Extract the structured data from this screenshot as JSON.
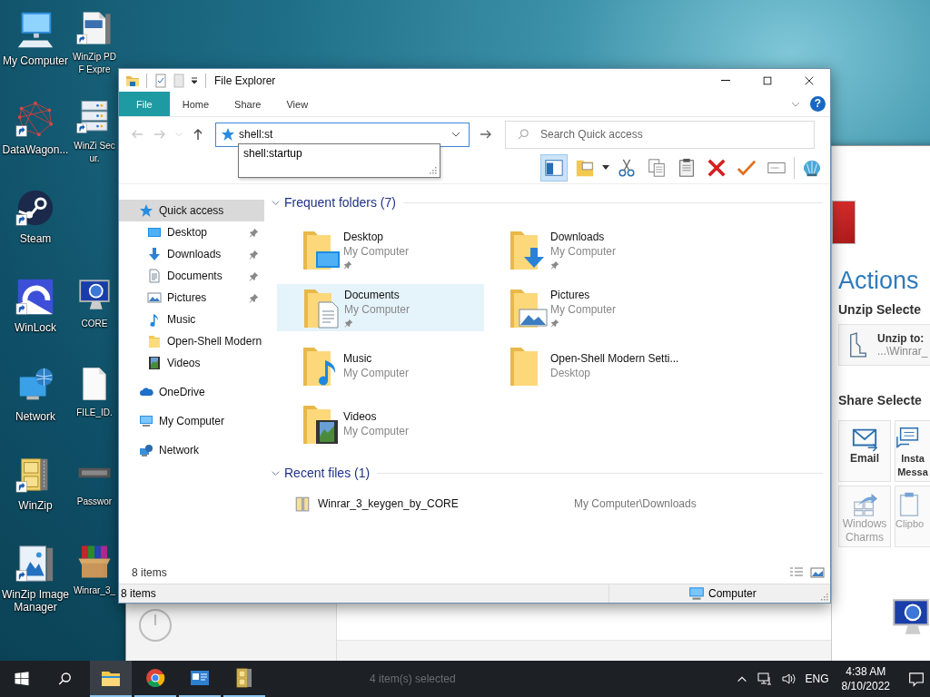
{
  "desktop": {
    "rows": [
      {
        "icons": [
          {
            "label": "My Computer",
            "kind": "computer",
            "shortcut": false
          },
          {
            "label": "WinZip PDF Expre",
            "kind": "pdf",
            "shortcut": true
          }
        ]
      },
      {
        "icons": [
          {
            "label": "DataWagon...",
            "kind": "graph",
            "shortcut": true
          },
          {
            "label": "WinZi Secur.",
            "kind": "server",
            "shortcut": true
          }
        ]
      },
      {
        "icons": [
          {
            "label": "Steam",
            "kind": "steam",
            "shortcut": true
          }
        ]
      },
      {
        "icons": [
          {
            "label": "WinLock",
            "kind": "winlock",
            "shortcut": true
          },
          {
            "label": "CORE",
            "kind": "info",
            "shortcut": false
          }
        ]
      },
      {
        "icons": [
          {
            "label": "Network",
            "kind": "network",
            "shortcut": false
          },
          {
            "label": "FILE_ID.",
            "kind": "file",
            "shortcut": false
          }
        ]
      },
      {
        "icons": [
          {
            "label": "WinZip",
            "kind": "cabinet",
            "shortcut": true
          },
          {
            "label": "Passwor",
            "kind": "password",
            "shortcut": false
          }
        ]
      },
      {
        "icons": [
          {
            "label": "WinZip Image Manager",
            "kind": "image",
            "shortcut": true
          },
          {
            "label": "Winrar_3_",
            "kind": "box",
            "shortcut": false
          }
        ]
      }
    ]
  },
  "background_window": {
    "actions": {
      "heading": "Actions",
      "unzip_heading": "Unzip Selecte",
      "unzip_card": {
        "title": "Unzip to:",
        "path": "...\\Winrar_"
      },
      "share_heading": "Share Selecte",
      "tiles": [
        {
          "label": "Email",
          "kind": "email",
          "disabled": false
        },
        {
          "label": "Insta Messa",
          "kind": "chat",
          "disabled": false
        },
        {
          "label": "Windows Charms",
          "kind": "charms",
          "disabled": true
        },
        {
          "label": "Clipbo",
          "kind": "clipboard",
          "disabled": true
        }
      ]
    },
    "status": "4 item(s) selected"
  },
  "explorer": {
    "title": "File Explorer",
    "ribbon_tabs": [
      {
        "label": "File",
        "kind": "menu"
      },
      {
        "label": "Home",
        "kind": "tab"
      },
      {
        "label": "Share",
        "kind": "tab"
      },
      {
        "label": "View",
        "kind": "tab"
      }
    ],
    "help_glyph": "?",
    "address": {
      "value": "shell:st",
      "suggestions": [
        "shell:startup"
      ]
    },
    "search": {
      "placeholder": "Search Quick access"
    },
    "nav": [
      {
        "label": "Quick access",
        "kind": "star",
        "selected": true,
        "children": [
          {
            "label": "Desktop",
            "kind": "desktop",
            "selected": false,
            "pinned": true
          },
          {
            "label": "Downloads",
            "kind": "download",
            "selected": false,
            "pinned": true
          },
          {
            "label": "Documents",
            "kind": "docs",
            "selected": false,
            "pinned": true
          },
          {
            "label": "Pictures",
            "kind": "pictures",
            "selected": false,
            "pinned": true
          },
          {
            "label": "Music",
            "kind": "music",
            "selected": false,
            "pinned": false
          },
          {
            "label": "Open-Shell Modern",
            "kind": "folder",
            "selected": false,
            "pinned": false
          },
          {
            "label": "Videos",
            "kind": "videos",
            "selected": false,
            "pinned": false
          }
        ]
      },
      {
        "label": "OneDrive",
        "kind": "cloud",
        "selected": false
      },
      {
        "label": "My Computer",
        "kind": "computer",
        "selected": false
      },
      {
        "label": "Network",
        "kind": "network",
        "selected": false
      }
    ],
    "sections": [
      {
        "title": "Frequent folders (7)",
        "kind": "folders",
        "expanded": true,
        "items": [
          {
            "name": "Desktop",
            "location": "My Computer",
            "kind": "desktop",
            "pinned": true,
            "selected": false
          },
          {
            "name": "Downloads",
            "location": "My Computer",
            "kind": "download",
            "pinned": true,
            "selected": false
          },
          {
            "name": "Documents",
            "location": "My Computer",
            "kind": "docs",
            "pinned": true,
            "selected": true
          },
          {
            "name": "Pictures",
            "location": "My Computer",
            "kind": "pictures",
            "pinned": true,
            "selected": false
          },
          {
            "name": "Music",
            "location": "My Computer",
            "kind": "music",
            "pinned": false,
            "selected": false
          },
          {
            "name": "Open-Shell Modern Setti...",
            "location": "Desktop",
            "kind": "folder",
            "pinned": false,
            "selected": false
          },
          {
            "name": "Videos",
            "location": "My Computer",
            "kind": "videos",
            "pinned": false,
            "selected": false
          }
        ]
      },
      {
        "title": "Recent files (1)",
        "kind": "files",
        "expanded": true,
        "items": [
          {
            "name": "Winrar_3_keygen_by_CORE",
            "location": "My Computer\\Downloads",
            "kind": "archive"
          }
        ]
      }
    ],
    "item_count": "8 items",
    "status_bar": {
      "left": "8 items",
      "right": "Computer"
    }
  },
  "taskbar": {
    "apps": [
      {
        "kind": "explorer",
        "selected": true
      },
      {
        "kind": "chrome",
        "selected": false
      },
      {
        "kind": "card",
        "selected": false
      },
      {
        "kind": "cabinet",
        "selected": false
      }
    ],
    "language": "ENG",
    "time": "4:38 AM",
    "date": "8/10/2022"
  }
}
